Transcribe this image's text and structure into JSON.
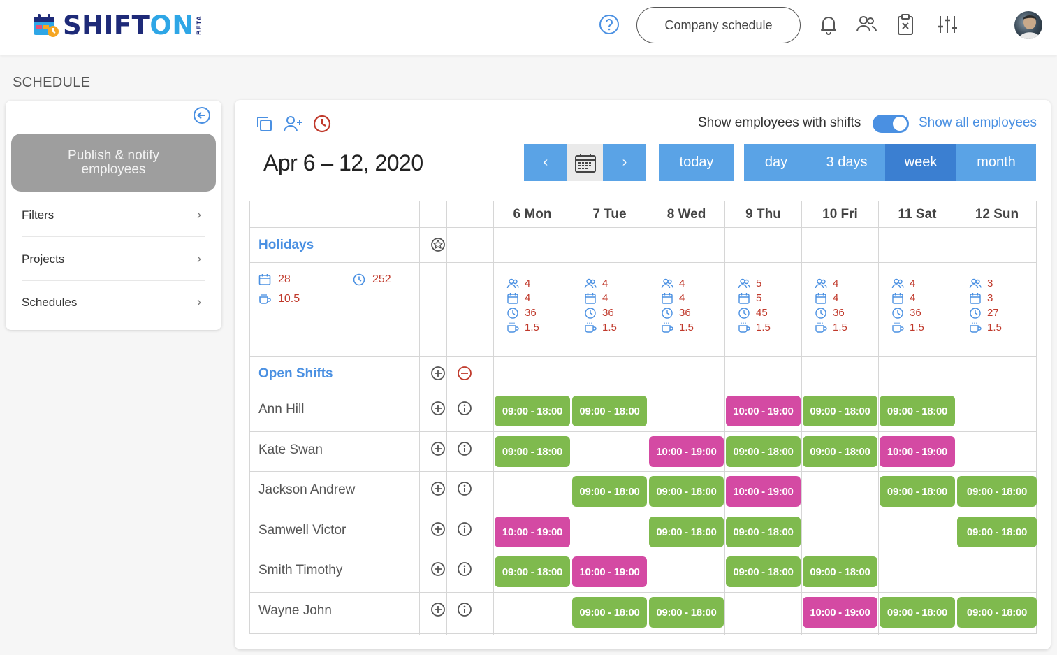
{
  "brand": {
    "name_main": "SHIFT",
    "name_accent": "ON",
    "badge": "BETA",
    "colors": {
      "navy": "#1e2a78",
      "accent": "#2ea6e6"
    }
  },
  "header": {
    "company_button": "Company schedule",
    "icons": [
      "help-icon",
      "bell-icon",
      "users-icon",
      "clipboard-icon",
      "sliders-icon"
    ]
  },
  "page": {
    "title": "SCHEDULE"
  },
  "sidebar": {
    "publish_label": "Publish & notify employees",
    "items": [
      {
        "label": "Filters"
      },
      {
        "label": "Projects"
      },
      {
        "label": "Schedules"
      }
    ]
  },
  "toolbar": {
    "toggle_label": "Show employees with shifts",
    "show_all_label": "Show all employees",
    "toggle_on": true
  },
  "nav": {
    "date_range": "Apr 6 – 12, 2020",
    "prev": "‹",
    "next": "›",
    "today": "today",
    "views": [
      "day",
      "3 days",
      "week",
      "month"
    ],
    "active_view": "week"
  },
  "days": [
    "6 Mon",
    "7 Tue",
    "8 Wed",
    "9 Thu",
    "10 Fri",
    "11 Sat",
    "12 Sun"
  ],
  "holidays_label": "Holidays",
  "totals": {
    "shifts": "28",
    "hours": "252",
    "breaks": "10.5"
  },
  "day_stats": [
    {
      "employees": "4",
      "shifts": "4",
      "hours": "36",
      "breaks": "1.5"
    },
    {
      "employees": "4",
      "shifts": "4",
      "hours": "36",
      "breaks": "1.5"
    },
    {
      "employees": "4",
      "shifts": "4",
      "hours": "36",
      "breaks": "1.5"
    },
    {
      "employees": "5",
      "shifts": "5",
      "hours": "45",
      "breaks": "1.5"
    },
    {
      "employees": "4",
      "shifts": "4",
      "hours": "36",
      "breaks": "1.5"
    },
    {
      "employees": "4",
      "shifts": "4",
      "hours": "36",
      "breaks": "1.5"
    },
    {
      "employees": "3",
      "shifts": "3",
      "hours": "27",
      "breaks": "1.5"
    }
  ],
  "open_shifts_label": "Open Shifts",
  "shift_colors": {
    "green": "#7fba4e",
    "magenta": "#d44aa3"
  },
  "employees": [
    {
      "name": "Ann Hill",
      "shifts": [
        "09:00 - 18:00",
        "09:00 - 18:00",
        "",
        "10:00 - 19:00",
        "09:00 - 18:00",
        "09:00 - 18:00",
        ""
      ]
    },
    {
      "name": "Kate Swan",
      "shifts": [
        "09:00 - 18:00",
        "",
        "10:00 - 19:00",
        "09:00 - 18:00",
        "09:00 - 18:00",
        "10:00 - 19:00",
        ""
      ]
    },
    {
      "name": "Jackson Andrew",
      "shifts": [
        "",
        "09:00 - 18:00",
        "09:00 - 18:00",
        "10:00 - 19:00",
        "",
        "09:00 - 18:00",
        "09:00 - 18:00"
      ]
    },
    {
      "name": "Samwell Victor",
      "shifts": [
        "10:00 - 19:00",
        "",
        "09:00 - 18:00",
        "09:00 - 18:00",
        "",
        "",
        "09:00 - 18:00"
      ]
    },
    {
      "name": "Smith Timothy",
      "shifts": [
        "09:00 - 18:00",
        "10:00 - 19:00",
        "",
        "09:00 - 18:00",
        "09:00 - 18:00",
        "",
        ""
      ]
    },
    {
      "name": "Wayne John",
      "shifts": [
        "",
        "09:00 - 18:00",
        "09:00 - 18:00",
        "",
        "10:00 - 19:00",
        "09:00 - 18:00",
        "09:00 - 18:00"
      ]
    }
  ]
}
